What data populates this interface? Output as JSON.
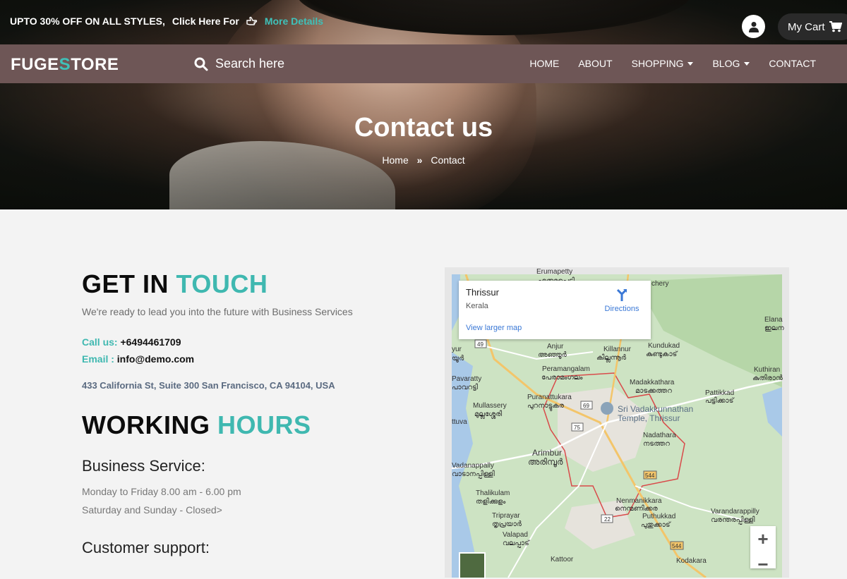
{
  "promo": {
    "text": "UPTO 30% OFF ON ALL STYLES,",
    "click": "Click Here For",
    "more": "More Details"
  },
  "header": {
    "cart_label": "My Cart"
  },
  "logo": {
    "part1": "FUGE",
    "part2": "S",
    "part3": "TORE"
  },
  "search": {
    "placeholder": "Search here"
  },
  "nav": {
    "items": [
      "HOME",
      "ABOUT",
      "SHOPPING",
      "BLOG",
      "CONTACT"
    ]
  },
  "hero": {
    "title": "Contact us",
    "crumb_home": "Home",
    "crumb_current": "Contact"
  },
  "touch": {
    "title_a": "GET IN",
    "title_b": "TOUCH",
    "subtitle": "We're ready to lead you into the future with Business Services"
  },
  "contact": {
    "call_label": "Call us:",
    "call_value": "+6494461709",
    "email_label": "Email :",
    "email_value": "info@demo.com",
    "address": "433 California St, Suite 300 San Francisco, CA 94104, USA"
  },
  "hours": {
    "title_a": "WORKING",
    "title_b": "HOURS",
    "service_title": "Business Service:",
    "service_weekday": "Monday to Friday 8.00 am - 6.00 pm",
    "service_weekend": "Saturday and Sunday - Closed>",
    "support_title": "Customer support:"
  },
  "map": {
    "place": "Thrissur",
    "region": "Kerala",
    "directions": "Directions",
    "larger": "View larger map",
    "labels": {
      "anjur": "Anjur",
      "anjur_ml": "അഞ്ഞൂർ",
      "killannur": "Killannur",
      "killannur_ml": "കില്ലന്നൂർ",
      "kundukad": "Kundukad",
      "kundukad_ml": "കുണ്ടുകാട്",
      "peramangalam": "Peramangalam",
      "peramangalam_ml": "പേരാമംഗലം",
      "madakkathara": "Madakkathara",
      "madakkathara_ml": "മാടക്കത്തറ",
      "pattikkad": "Pattikkad",
      "pattikkad_ml": "പട്ടിക്കാട്",
      "puranattukara": "Puranattukara",
      "puranattukara_ml": "പുറനാട്ടുകര",
      "temple": "Sri Vadakkunnathan",
      "temple2": "Temple, Thrissur",
      "mullassery": "Mullassery",
      "mullassery_ml": "മുല്ലശ്ശേരി",
      "pavaratty": "Pavaratty",
      "pavaratty_ml": "പാവറട്ടി",
      "nadathara": "Nadathara",
      "nadathara_ml": "നടത്തറ",
      "arimbur": "Arimbur",
      "arimbur_ml": "അരിമ്പൂർ",
      "vadanappally": "Vadanappally",
      "vadanappally_ml": "വാടാനപ്പിള്ളി",
      "thalikulam": "Thalikulam",
      "thalikulam_ml": "തളിക്കുളം",
      "nenmanikkara": "Nenmanikkara",
      "nenmanikkara_ml": "നെന്മണിക്കര",
      "varandarappilly": "Varandarappilly",
      "varandarappilly_ml": "വരന്തരപ്പിള്ളി",
      "triprayar": "Triprayar",
      "triprayar_ml": "തൃപ്രയാർ",
      "puthukkad": "Puthukkad",
      "puthukkad_ml": "പുതുക്കാട്",
      "valapad": "Valapad",
      "valapad_ml": "വലപ്പാട്",
      "kattoor": "Kattoor",
      "kodakara": "Kodakara",
      "kuthiran": "Kuthiran",
      "kuthiran_ml": "കുതിരാൻ",
      "elanad": "Elana",
      "elanad_ml": "ഇലന",
      "chery": "chery",
      "yur": "yur",
      "yur_ml": "യൂർ",
      "ttuva": "ttuva",
      "erumapetty": "Erumapetty",
      "erumapetty_ml": "എരുമപ്പെട്ടി",
      "r49": "49",
      "r69": "69",
      "r75": "75",
      "r544": "544",
      "r544b": "544",
      "r22": "22"
    }
  },
  "colors": {
    "accent": "#3fb8b0",
    "nav": "#6e5656"
  }
}
